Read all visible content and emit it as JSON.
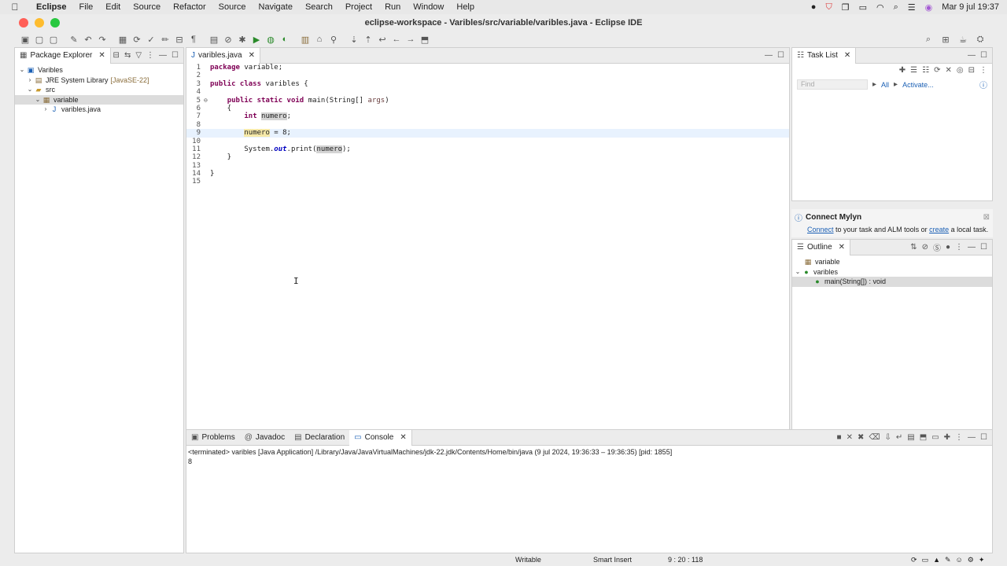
{
  "menubar": {
    "app": "Eclipse",
    "items": [
      "File",
      "Edit",
      "Source",
      "Refactor",
      "Source",
      "Navigate",
      "Search",
      "Project",
      "Run",
      "Window",
      "Help"
    ],
    "clock": "Mar 9 jul  19:37"
  },
  "window": {
    "title": "eclipse-workspace - Varibles/src/variable/varibles.java - Eclipse IDE",
    "traffic_colors": [
      "#ff5f57",
      "#febc2e",
      "#28c840"
    ]
  },
  "package_explorer": {
    "title": "Package Explorer",
    "tree": [
      {
        "label": "Varibles",
        "depth": 0,
        "twist": "⌄",
        "icon": "project-icon"
      },
      {
        "label": "JRE System Library",
        "decoration": "[JavaSE-22]",
        "depth": 1,
        "twist": "›",
        "icon": "library-icon"
      },
      {
        "label": "src",
        "depth": 1,
        "twist": "⌄",
        "icon": "source-folder-icon"
      },
      {
        "label": "variable",
        "depth": 2,
        "twist": "⌄",
        "icon": "package-icon",
        "selected": true
      },
      {
        "label": "varibles.java",
        "depth": 3,
        "twist": "›",
        "icon": "java-file-icon"
      }
    ]
  },
  "editor": {
    "tab_label": "varibles.java",
    "current_line": 9,
    "lines": [
      "package variable;",
      "",
      "public class varibles {",
      "",
      "    public static void main(String[] args)",
      "    {",
      "        int numero;",
      "",
      "        numero = 8;",
      "",
      "        System.out.print(numero);",
      "    }",
      "",
      "}",
      ""
    ]
  },
  "task_list": {
    "title": "Task List",
    "find_placeholder": "Find",
    "all_label": "All",
    "activate_label": "Activate..."
  },
  "mylyn": {
    "title": "Connect Mylyn",
    "connect": "Connect",
    "middle": " to your task and ALM tools or ",
    "create": "create",
    "end": " a local task."
  },
  "outline": {
    "title": "Outline",
    "items": [
      {
        "label": "variable",
        "icon": "package-icon"
      },
      {
        "label": "varibles",
        "icon": "class-icon"
      },
      {
        "label": "main(String[]) : void",
        "icon": "method-icon"
      }
    ]
  },
  "console": {
    "tabs": [
      "Problems",
      "Javadoc",
      "Declaration",
      "Console"
    ],
    "terminated": "<terminated> varibles [Java Application] /Library/Java/JavaVirtualMachines/jdk-22.jdk/Contents/Home/bin/java  (9 jul 2024, 19:36:33 – 19:36:35) [pid: 1855]",
    "output": "8"
  },
  "statusbar": {
    "writable": "Writable",
    "insert_mode": "Smart Insert",
    "position": "9 : 20 : 118"
  }
}
